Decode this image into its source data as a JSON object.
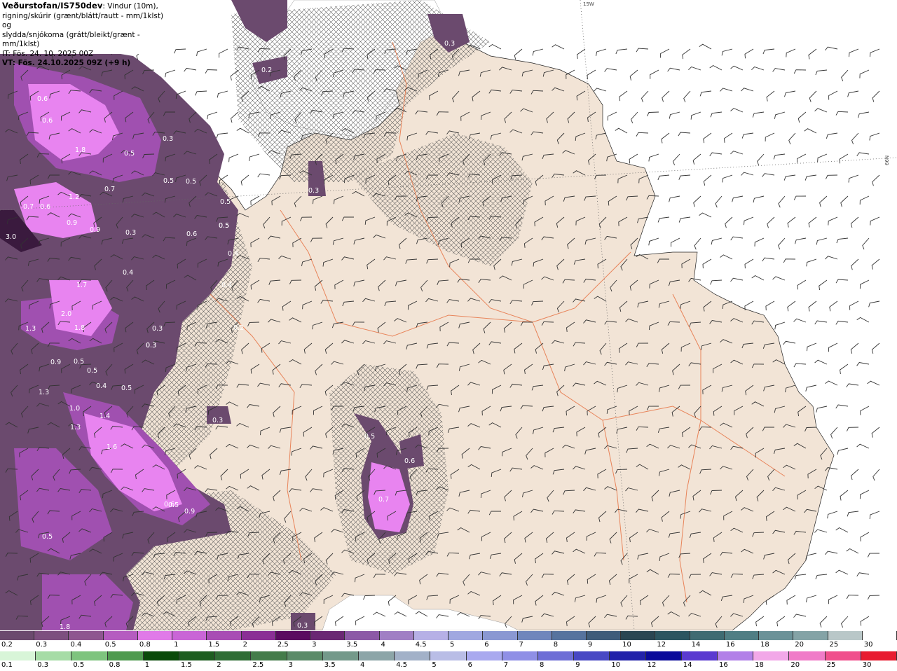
{
  "header": {
    "brand": "Veðurstofan/IS750dev",
    "description_1": ": Vindur (10m),",
    "description_2": "rigning/skúrir (grænt/blátt/rautt - mm/1klst) og",
    "description_3": "slydda/snjókoma (grátt/bleikt/grænt - mm/1klst)",
    "initial_time": "IT: Fös. 24. 10. 2025 00Z",
    "valid_time": "VT: Fös. 24.10.2025 09Z (+9 h)"
  },
  "map": {
    "coord_label_top": "15W",
    "coord_label_right": "66N",
    "precip_labels": [
      "0.4",
      "0.2",
      "0.6",
      "0.6",
      "0.3",
      "1.8",
      "0.5",
      "0.5",
      "0.5",
      "0.5",
      "1.2",
      "0.7",
      "0.7",
      "0.6",
      "0.9",
      "0.9",
      "0.3",
      "0.5",
      "0.6",
      "0.4",
      "0.4",
      "0.4",
      "0.3",
      "0.3",
      "0.2",
      "1.7",
      "2.0",
      "1.8",
      "1.3",
      "0.9",
      "0.5",
      "0.5",
      "0.4",
      "0.5",
      "1.3",
      "1.0",
      "1.4",
      "1.3",
      "1.6",
      "0.3",
      "0.3",
      "0.5",
      "0.5",
      "0.6",
      "0.5",
      "0.9",
      "0.5",
      "1.8",
      "0.3",
      "0.3",
      "0.6",
      "0.7",
      "0.3",
      "3.0"
    ]
  },
  "legend_top": {
    "labels": [
      "0.2",
      "0.3",
      "0.4",
      "0.5",
      "0.8",
      "1",
      "1.5",
      "2",
      "2.5",
      "3",
      "3.5",
      "4",
      "4.5",
      "5",
      "6",
      "7",
      "8",
      "9",
      "10",
      "12",
      "14",
      "16",
      "18",
      "20",
      "25",
      "30"
    ],
    "colors": [
      "#6b4a6e",
      "#7d4f7f",
      "#8e5690",
      "#b55cc0",
      "#e07ae8",
      "#c965d6",
      "#a84db4",
      "#8a2f95",
      "#5a0b60",
      "#6a2873",
      "#8c59a6",
      "#a07fc4",
      "#b6b0e6",
      "#a0a8e0",
      "#8a98d2",
      "#6f86bc",
      "#56739e",
      "#3f5c7a",
      "#2a4652",
      "#2c5560",
      "#3f6b72",
      "#507e84",
      "#6b9298",
      "#84a3a6",
      "#b9c7c8",
      "#ffffff"
    ]
  },
  "legend_bottom": {
    "labels": [
      "0.1",
      "0.3",
      "0.5",
      "0.8",
      "1",
      "1.5",
      "2",
      "2.5",
      "3",
      "3.5",
      "4",
      "4.5",
      "5",
      "6",
      "7",
      "8",
      "9",
      "10",
      "12",
      "14",
      "16",
      "18",
      "20",
      "25",
      "30"
    ],
    "colors": [
      "#d8f5d8",
      "#a6dca6",
      "#7ec47e",
      "#4f9a4f",
      "#0a4a0a",
      "#1d5d20",
      "#2f6d35",
      "#447c4a",
      "#5b8b68",
      "#74998a",
      "#8ca5a8",
      "#a2b1c8",
      "#b9bde6",
      "#a9a9ef",
      "#8f8fe6",
      "#6e6ed6",
      "#4848c4",
      "#2222aa",
      "#0b0b9a",
      "#5a3ad0",
      "#b280e8",
      "#f2a8e8",
      "#f07cc8",
      "#f0508c",
      "#e81c30"
    ]
  },
  "colors": {
    "land": "#f2e4d6",
    "sea": "#ffffff",
    "roads": "#e8845a",
    "precip_dark": "#6b4a6e",
    "precip_mid": "#a050b0",
    "precip_bright": "#e884f0"
  }
}
